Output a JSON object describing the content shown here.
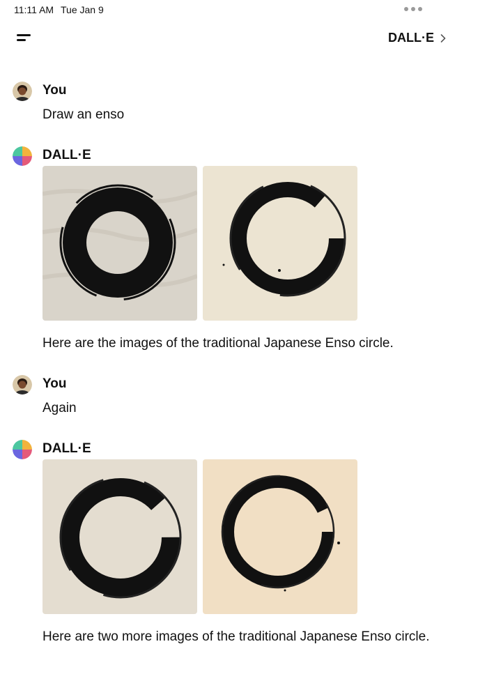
{
  "status_bar": {
    "time": "11:11 AM",
    "date": "Tue Jan 9"
  },
  "nav": {
    "title": "DALL·E",
    "menu_icon": "hamburger-menu-icon",
    "chevron_icon": "chevron-right-icon"
  },
  "messages": [
    {
      "role": "user",
      "sender": "You",
      "text": "Draw an enso"
    },
    {
      "role": "assistant",
      "sender": "DALL·E",
      "images": [
        "enso-image-1",
        "enso-image-2"
      ],
      "text": "Here are the images of the traditional Japanese Enso circle."
    },
    {
      "role": "user",
      "sender": "You",
      "text": "Again"
    },
    {
      "role": "assistant",
      "sender": "DALL·E",
      "images": [
        "enso-image-3",
        "enso-image-4"
      ],
      "text": "Here are two more images of the traditional Japanese Enso circle."
    }
  ]
}
